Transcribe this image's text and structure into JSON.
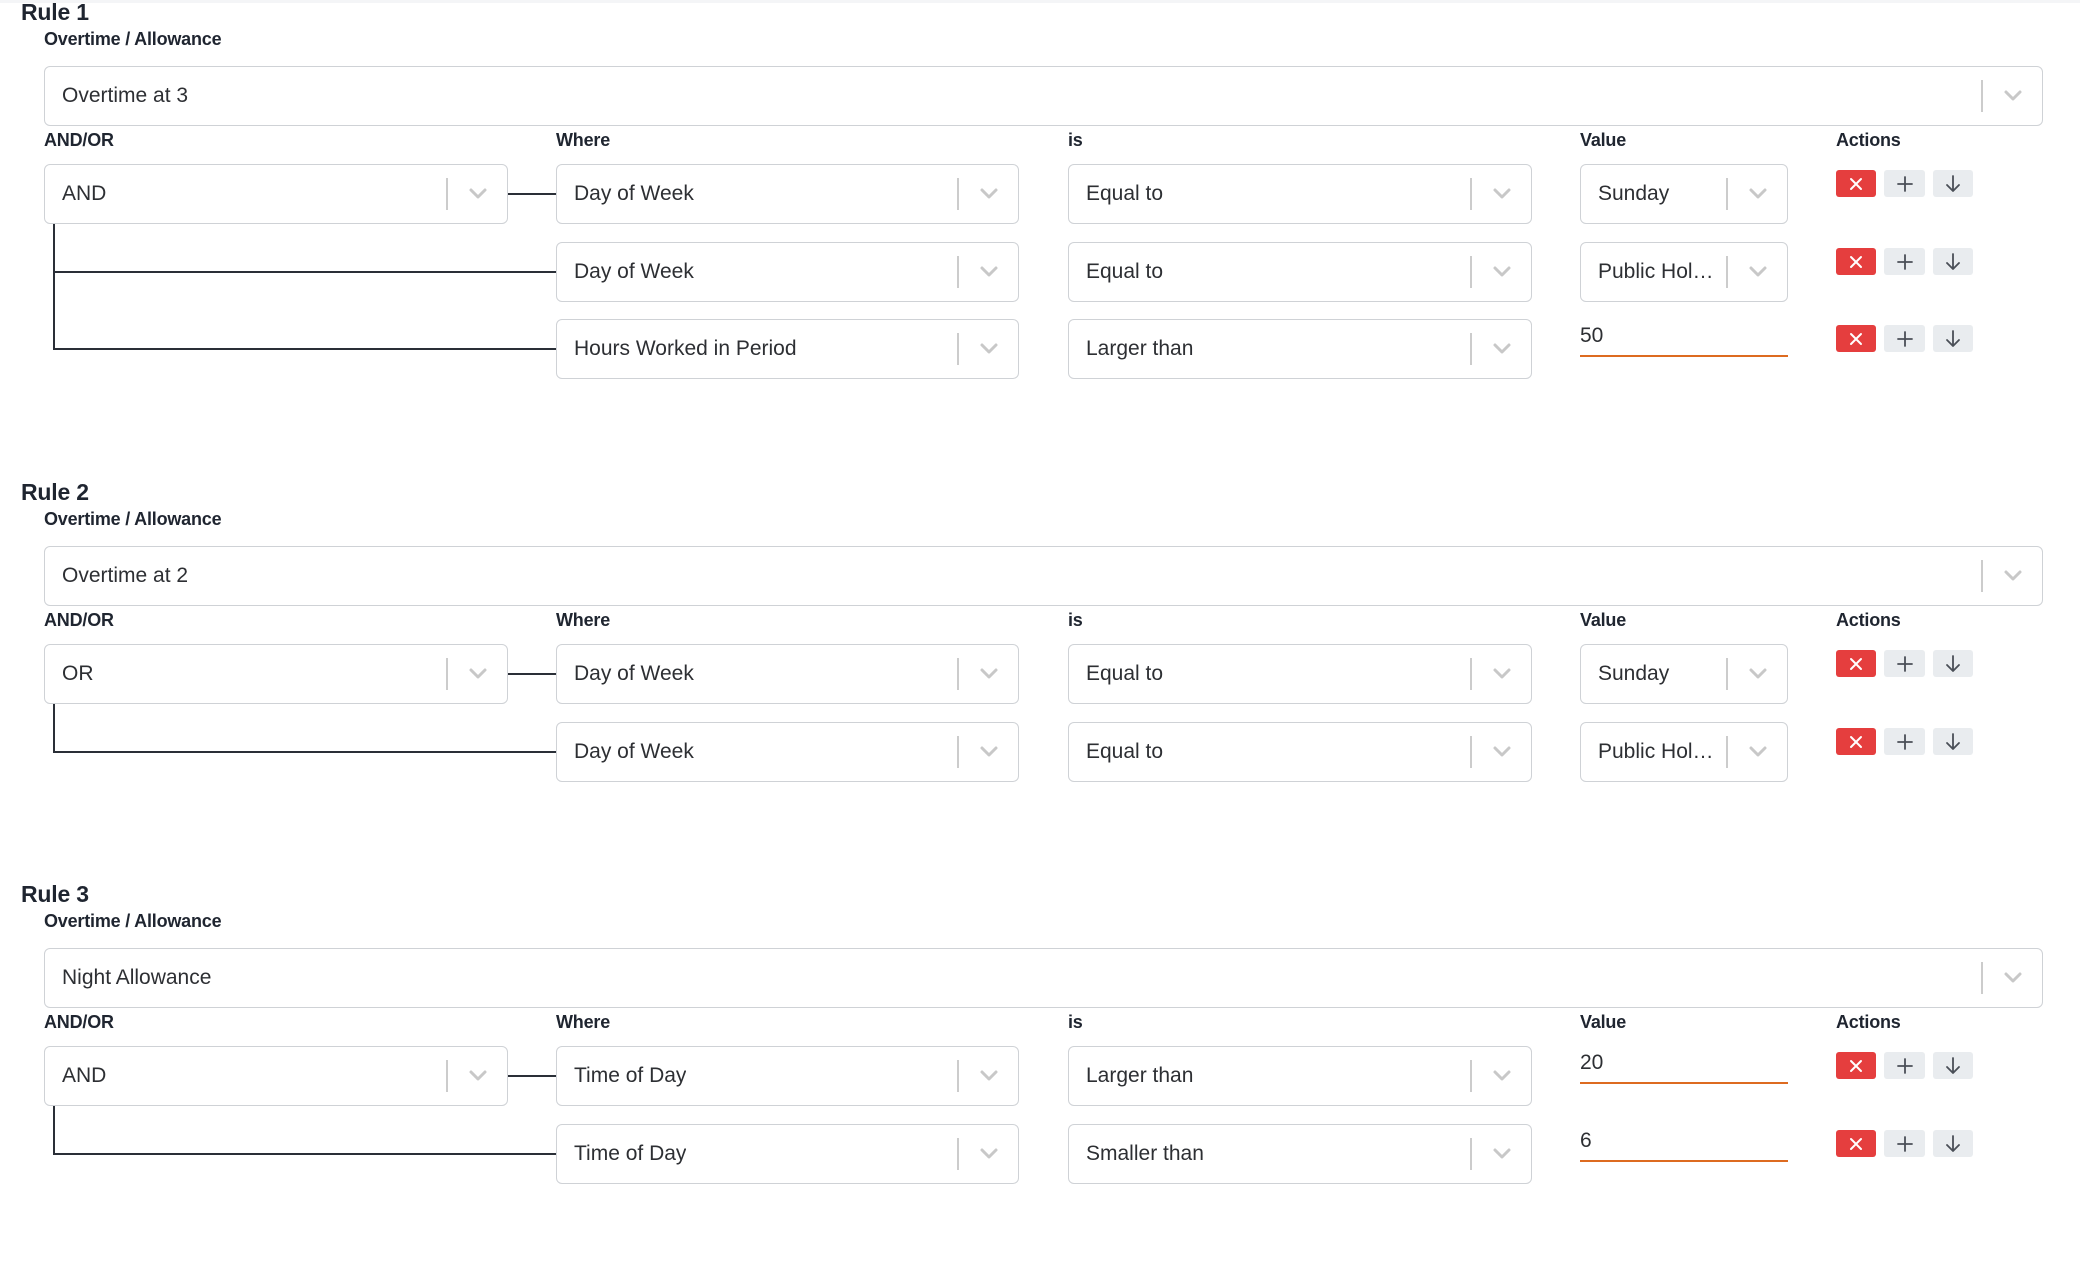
{
  "labels": {
    "category": "Overtime / Allowance",
    "andor": "AND/OR",
    "where": "Where",
    "is": "is",
    "value": "Value",
    "actions": "Actions"
  },
  "colors": {
    "delete_button": "#e53e3e",
    "secondary_button": "#e9ecef",
    "input_underline": "#dd6b20",
    "connector_line": "#2a2f37"
  },
  "icons": {
    "delete": "close-icon",
    "add": "plus-icon",
    "move_down": "arrow-down-icon",
    "dropdown": "chevron-down-icon"
  },
  "rules": [
    {
      "title": "Rule 1",
      "category_value": "Overtime at 3",
      "operator": "AND",
      "conditions": [
        {
          "where": "Day of Week",
          "is": "Equal to",
          "value": "Sunday",
          "value_type": "select"
        },
        {
          "where": "Day of Week",
          "is": "Equal to",
          "value": "Public Holi…",
          "value_type": "select"
        },
        {
          "where": "Hours Worked in Period",
          "is": "Larger than",
          "value": "50",
          "value_type": "text"
        }
      ]
    },
    {
      "title": "Rule 2",
      "category_value": "Overtime at 2",
      "operator": "OR",
      "conditions": [
        {
          "where": "Day of Week",
          "is": "Equal to",
          "value": "Sunday",
          "value_type": "select"
        },
        {
          "where": "Day of Week",
          "is": "Equal to",
          "value": "Public Holi…",
          "value_type": "select"
        }
      ]
    },
    {
      "title": "Rule 3",
      "category_value": "Night Allowance",
      "operator": "AND",
      "conditions": [
        {
          "where": "Time of Day",
          "is": "Larger than",
          "value": "20",
          "value_type": "text"
        },
        {
          "where": "Time of Day",
          "is": "Smaller than",
          "value": "6",
          "value_type": "text"
        }
      ]
    }
  ]
}
